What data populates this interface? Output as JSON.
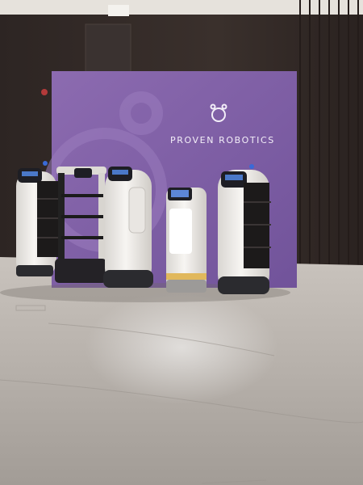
{
  "backdrop": {
    "brand_text": "PROVEN ROBOTICS",
    "logo_icon": "bear-head-logo-icon",
    "color": "#7e5fa2"
  },
  "scene": {
    "robots": [
      {
        "name": "robot-1",
        "type": "delivery robot with trays"
      },
      {
        "name": "robot-2",
        "type": "open shelf delivery robot"
      },
      {
        "name": "robot-3",
        "type": "service robot"
      },
      {
        "name": "robot-4",
        "type": "display robot with lit screen"
      },
      {
        "name": "robot-5",
        "type": "delivery robot with trays"
      }
    ]
  }
}
